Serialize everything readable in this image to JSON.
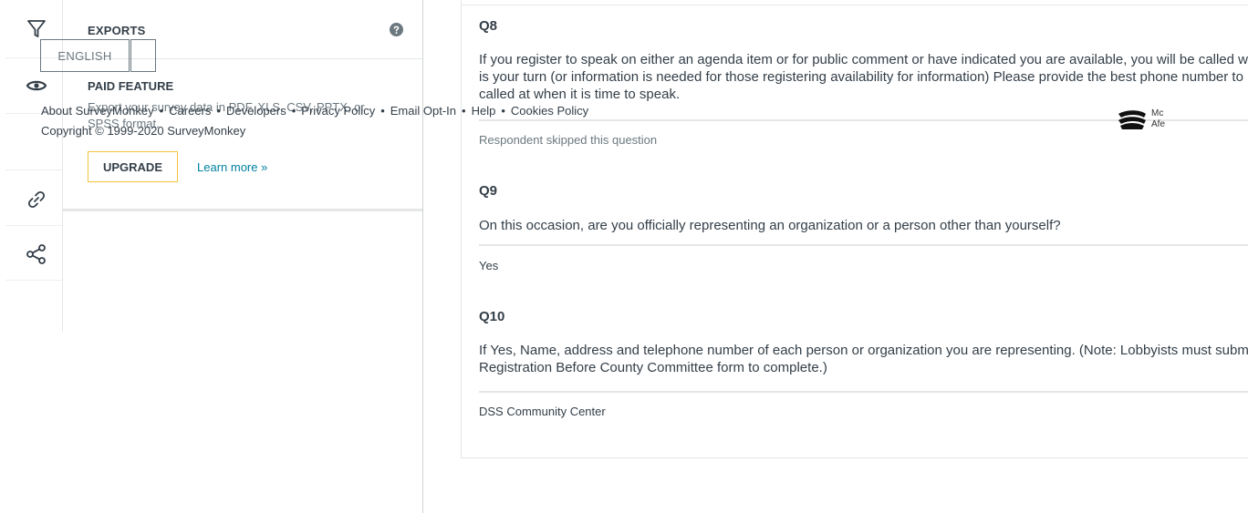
{
  "sidebar": {
    "icons": [
      "filter-icon",
      "eye-icon",
      "link-icon",
      "share-icon"
    ]
  },
  "exports": {
    "title": "EXPORTS",
    "help_icon": "question-circle-icon",
    "paid_feature_title": "PAID FEATURE",
    "description": "Export your survey data in PDF, XLS, CSV, PPTX, or SPSS format.",
    "upgrade_label": "UPGRADE",
    "learn_more_label": "Learn more »"
  },
  "footer": {
    "language_label": "ENGLISH",
    "links": [
      "About SurveyMonkey",
      "Careers",
      "Developers",
      "Privacy Policy",
      "Email Opt-In",
      "Help",
      "Cookies Policy"
    ],
    "separator": "•",
    "copyright": "Copyright © 1999-2020 SurveyMonkey",
    "badge_text_line1": "Mc",
    "badge_text_line2": "Afe"
  },
  "questions": [
    {
      "number": "Q8",
      "text": "If you register to speak on either an agenda item or for public comment or have indicated you are available, you will be called when it is your turn (or information is needed for those registering availability for information) Please provide the best phone number to be called at when it is time to speak.",
      "answer": "Respondent skipped this question"
    },
    {
      "number": "Q9",
      "text": "On this occasion, are you officially representing an organization or a person other than yourself?",
      "answer": "Yes"
    },
    {
      "number": "Q10",
      "text": "If Yes, Name, address and telephone number of each person or organization you are representing. (Note: Lobbyists must submit full Registration Before County Committee form to complete.)",
      "answer": "DSS Community Center"
    }
  ],
  "colors": {
    "accent_link": "#00819f",
    "upgrade_border": "#f4c43b",
    "text_primary": "#333e48",
    "text_muted": "#6b787f"
  }
}
